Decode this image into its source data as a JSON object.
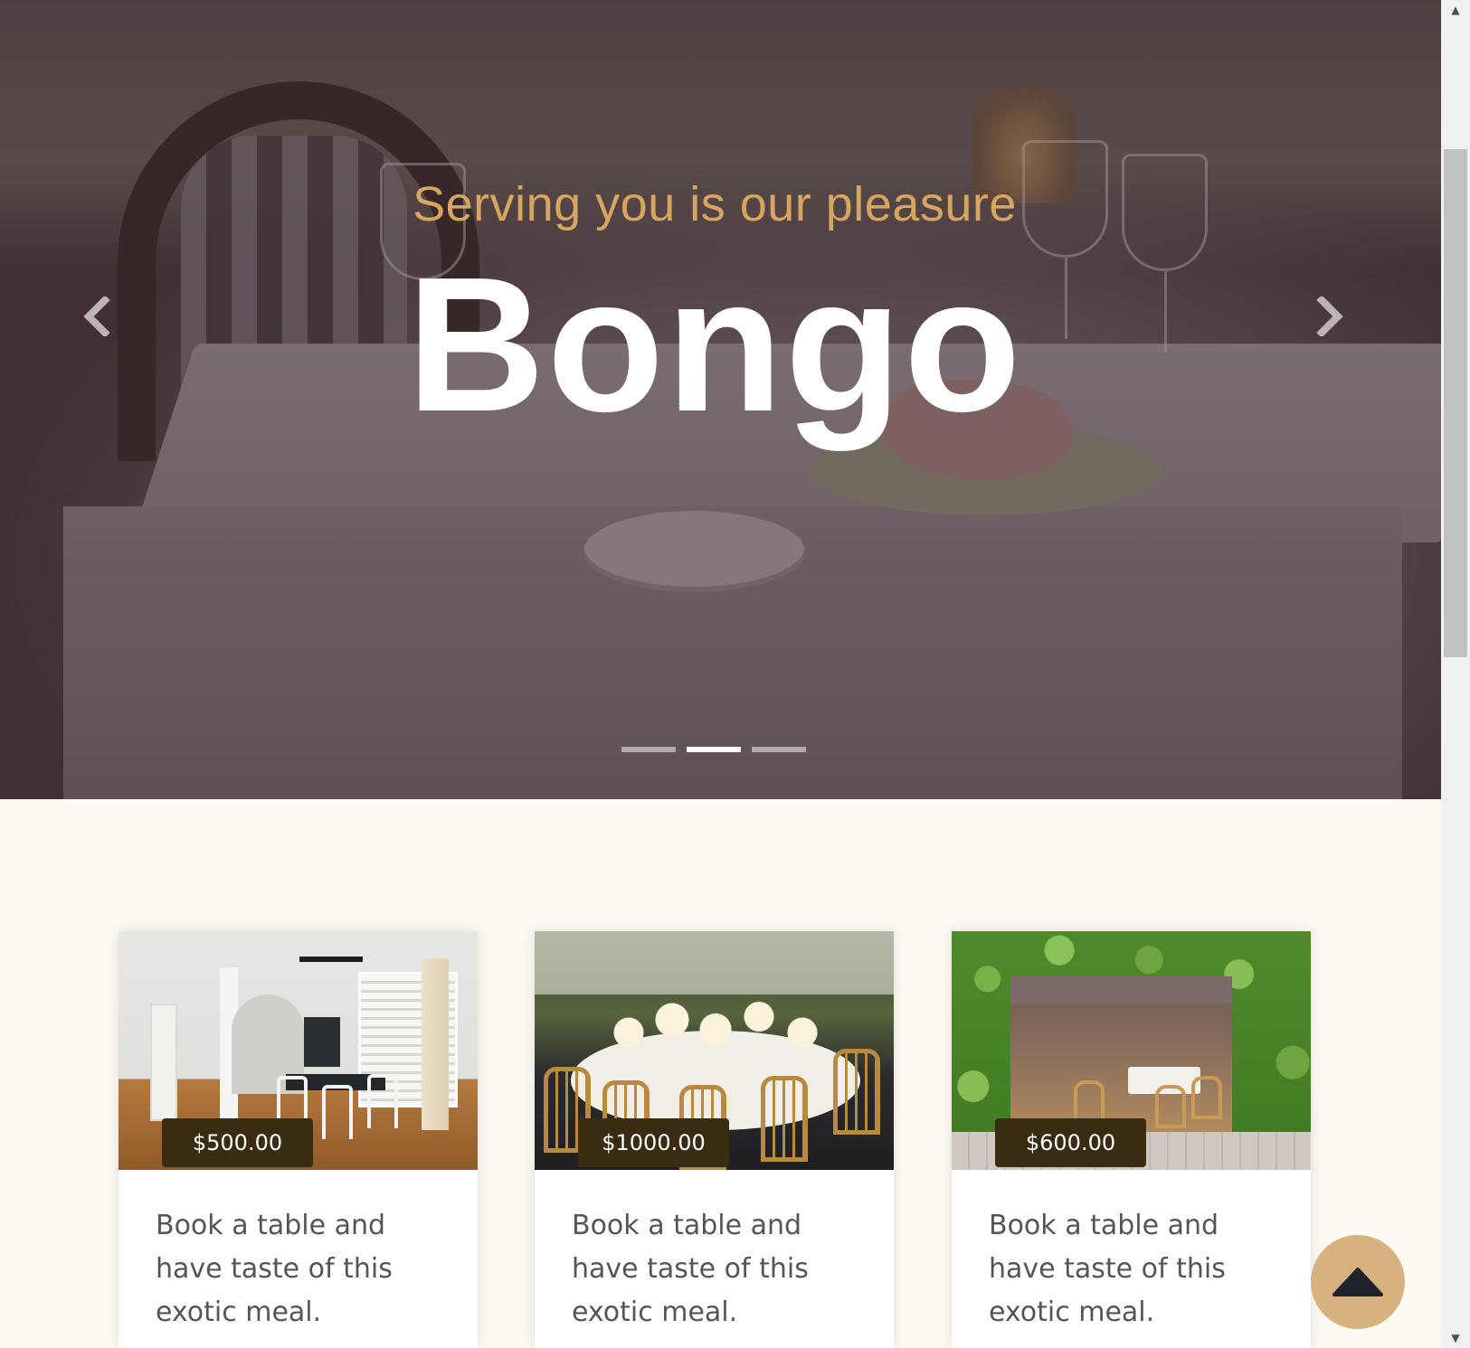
{
  "hero": {
    "subtitle": "Serving you is our pleasure",
    "title": "Bongo",
    "prev_icon": "chevron-left-icon",
    "next_icon": "chevron-right-icon",
    "slides_count": 3,
    "active_slide": 2,
    "colors": {
      "subtitle": "#d6a55f",
      "title": "#ffffff"
    }
  },
  "cards": [
    {
      "price": "$500.00",
      "text": "Book a table and have taste of this exotic meal.",
      "image": "dining-room-photo"
    },
    {
      "price": "$1000.00",
      "text": "Book a table and have taste of this exotic meal.",
      "image": "banquet-table-photo"
    },
    {
      "price": "$600.00",
      "text": "Book a table and have taste of this exotic meal.",
      "image": "patio-restaurant-photo"
    }
  ],
  "back_to_top": {
    "icon": "triangle-up-icon",
    "color": "#d7b27e"
  },
  "colors": {
    "page_background": "#fdf9f3",
    "badge_background": "#3a2c12"
  }
}
